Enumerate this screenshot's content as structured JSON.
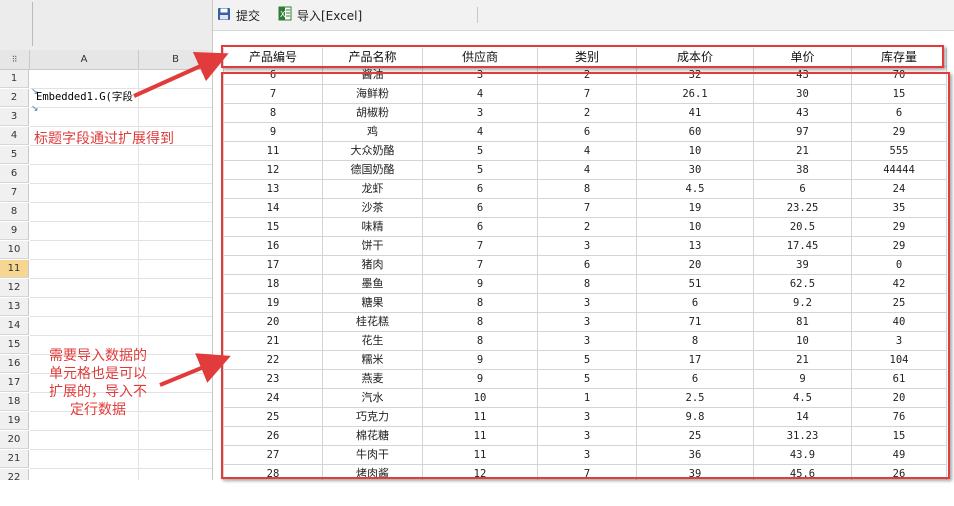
{
  "toolbar": {
    "submit_label": "提交",
    "import_label": "导入[Excel]",
    "submit_icon": "save-icon",
    "import_icon": "excel-icon"
  },
  "sheet": {
    "columns": [
      "A",
      "B"
    ],
    "rows": [
      "1",
      "2",
      "3",
      "4",
      "5",
      "6",
      "7",
      "8",
      "9",
      "10",
      "11",
      "12",
      "13",
      "14",
      "15",
      "16",
      "17",
      "18",
      "19",
      "20",
      "21",
      "22"
    ],
    "selected_row": "11",
    "cell_a2": "Embedded1.G(字段",
    "corner": "⠿"
  },
  "annotations": {
    "title_note": "标题字段通过扩展得到",
    "data_note_lines": [
      "需要导入数据的",
      "单元格也是可以",
      "扩展的，导入不",
      "定行数据"
    ],
    "accent_color": "#e23b3b"
  },
  "table": {
    "headers": [
      "产品编号",
      "产品名称",
      "供应商",
      "类别",
      "成本价",
      "单价",
      "库存量"
    ],
    "rows": [
      [
        "6",
        "酱油",
        "3",
        "2",
        "32",
        "43",
        "70"
      ],
      [
        "7",
        "海鲜粉",
        "4",
        "7",
        "26.1",
        "30",
        "15"
      ],
      [
        "8",
        "胡椒粉",
        "3",
        "2",
        "41",
        "43",
        "6"
      ],
      [
        "9",
        "鸡",
        "4",
        "6",
        "60",
        "97",
        "29"
      ],
      [
        "11",
        "大众奶酪",
        "5",
        "4",
        "10",
        "21",
        "555"
      ],
      [
        "12",
        "德国奶酪",
        "5",
        "4",
        "30",
        "38",
        "44444"
      ],
      [
        "13",
        "龙虾",
        "6",
        "8",
        "4.5",
        "6",
        "24"
      ],
      [
        "14",
        "沙茶",
        "6",
        "7",
        "19",
        "23.25",
        "35"
      ],
      [
        "15",
        "味精",
        "6",
        "2",
        "10",
        "20.5",
        "29"
      ],
      [
        "16",
        "饼干",
        "7",
        "3",
        "13",
        "17.45",
        "29"
      ],
      [
        "17",
        "猪肉",
        "7",
        "6",
        "20",
        "39",
        "0"
      ],
      [
        "18",
        "墨鱼",
        "9",
        "8",
        "51",
        "62.5",
        "42"
      ],
      [
        "19",
        "糖果",
        "8",
        "3",
        "6",
        "9.2",
        "25"
      ],
      [
        "20",
        "桂花糕",
        "8",
        "3",
        "71",
        "81",
        "40"
      ],
      [
        "21",
        "花生",
        "8",
        "3",
        "8",
        "10",
        "3"
      ],
      [
        "22",
        "糯米",
        "9",
        "5",
        "17",
        "21",
        "104"
      ],
      [
        "23",
        "燕麦",
        "9",
        "5",
        "6",
        "9",
        "61"
      ],
      [
        "24",
        "汽水",
        "10",
        "1",
        "2.5",
        "4.5",
        "20"
      ],
      [
        "25",
        "巧克力",
        "11",
        "3",
        "9.8",
        "14",
        "76"
      ],
      [
        "26",
        "棉花糖",
        "11",
        "3",
        "25",
        "31.23",
        "15"
      ],
      [
        "27",
        "牛肉干",
        "11",
        "3",
        "36",
        "43.9",
        "49"
      ],
      [
        "28",
        "烤肉酱",
        "12",
        "7",
        "39",
        "45.6",
        "26"
      ]
    ]
  }
}
